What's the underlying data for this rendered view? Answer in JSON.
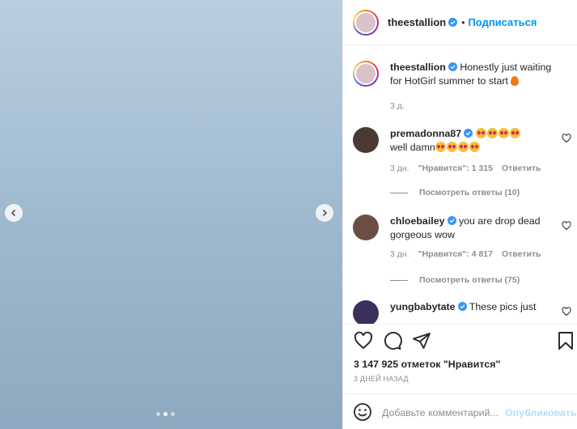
{
  "post": {
    "author": "theestallion",
    "follow_label": "Подписаться",
    "separator": "•",
    "caption": "Honestly just waiting for HotGirl summer to start",
    "caption_time": "3 д."
  },
  "comments": [
    {
      "username": "premadonna87",
      "text_line1": "",
      "text_line2": "well damn",
      "time": "3 дн.",
      "likes": "\"Нравится\": 1 315",
      "reply_label": "Ответить",
      "view_replies": "Посмотреть ответы (10)"
    },
    {
      "username": "chloebailey",
      "text": "you are drop dead gorgeous wow",
      "time": "3 дн.",
      "likes": "\"Нравится\": 4 817",
      "reply_label": "Ответить",
      "view_replies": "Посмотреть ответы (75)"
    },
    {
      "username": "yungbabytate",
      "text": "These pics just"
    }
  ],
  "actions": {
    "likes_count": "3 147 925 отметок \"Нравится\"",
    "posted_time": "3 ДНЕЙ НАЗАД"
  },
  "add_comment": {
    "placeholder": "Добавьте комментарий...",
    "publish_label": "Опубликовать"
  },
  "carousel": {
    "slide_count": 3,
    "active_index": 1
  },
  "colors": {
    "link_blue": "#0095f6",
    "muted": "#8e8e8e",
    "verified_blue": "#3897f0",
    "background": "#9fb8cf"
  }
}
